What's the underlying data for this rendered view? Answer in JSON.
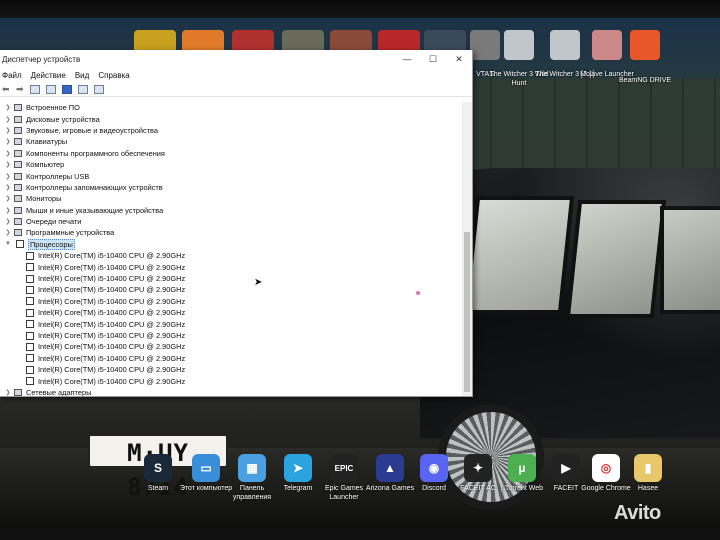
{
  "window": {
    "title": "Диспетчер устройств",
    "menu": [
      "Файл",
      "Действие",
      "Вид",
      "Справка"
    ],
    "controls": {
      "minimize": "—",
      "maximize": "☐",
      "close": "✕"
    }
  },
  "tree": {
    "categories": [
      "Встроенное ПО",
      "Дисковые устройства",
      "Звуковые, игровые и видеоустройства",
      "Клавиатуры",
      "Компоненты программного обеспечения",
      "Компьютер",
      "Контроллеры USB",
      "Контроллеры запоминающих устройств",
      "Мониторы",
      "Мыши и иные указывающие устройства",
      "Очереди печати",
      "Программные устройства"
    ],
    "expanded_category": "Процессоры",
    "processors": [
      "Intel(R) Core(TM) i5-10400 CPU @ 2.90GHz",
      "Intel(R) Core(TM) i5-10400 CPU @ 2.90GHz",
      "Intel(R) Core(TM) i5-10400 CPU @ 2.90GHz",
      "Intel(R) Core(TM) i5-10400 CPU @ 2.90GHz",
      "Intel(R) Core(TM) i5-10400 CPU @ 2.90GHz",
      "Intel(R) Core(TM) i5-10400 CPU @ 2.90GHz",
      "Intel(R) Core(TM) i5-10400 CPU @ 2.90GHz",
      "Intel(R) Core(TM) i5-10400 CPU @ 2.90GHz",
      "Intel(R) Core(TM) i5-10400 CPU @ 2.90GHz",
      "Intel(R) Core(TM) i5-10400 CPU @ 2.90GHz",
      "Intel(R) Core(TM) i5-10400 CPU @ 2.90GHz",
      "Intel(R) Core(TM) i5-10400 CPU @ 2.90GHz"
    ],
    "partial_last": "Сетевые адаптеры"
  },
  "desktop_top": [
    {
      "label": "VTAS",
      "color": "#7a7a7a"
    },
    {
      "label": "The Witcher 3 Wild Hunt",
      "color": "#c0c6cc"
    },
    {
      "label": "The Witcher 3 [7.1]",
      "color": "#c0c6cc"
    },
    {
      "label": "Mojave Launcher",
      "color": "#c88"
    },
    {
      "label": "BeamNG DRIVE",
      "color": "#e8562a"
    }
  ],
  "dock": [
    {
      "label": "Steam",
      "color": "#1b2838",
      "glyph": "S"
    },
    {
      "label": "Этот компьютер",
      "color": "#3a8ed8",
      "glyph": "▭"
    },
    {
      "label": "Панель управления",
      "color": "#4aa0e0",
      "glyph": "▦"
    },
    {
      "label": "Telegram",
      "color": "#2aa3df",
      "glyph": "➤"
    },
    {
      "label": "Epic Games Launcher",
      "color": "#222",
      "glyph": "EPIC"
    },
    {
      "label": "Arizona Games",
      "color": "#2b3b8f",
      "glyph": "▲"
    },
    {
      "label": "Discord",
      "color": "#5865f2",
      "glyph": "◉"
    },
    {
      "label": "FACEIT AC",
      "color": "#222",
      "glyph": "✦"
    },
    {
      "label": "µTorrent Web",
      "color": "#4caf50",
      "glyph": "µ"
    },
    {
      "label": "FACEIT",
      "color": "#222",
      "glyph": "▶"
    },
    {
      "label": "Google Chrome",
      "color": "#ffffff",
      "glyph": "◎"
    },
    {
      "label": "Hasee",
      "color": "#e8c66a",
      "glyph": "▮"
    }
  ],
  "plate": "M·UY 8714",
  "watermark": "Avito"
}
